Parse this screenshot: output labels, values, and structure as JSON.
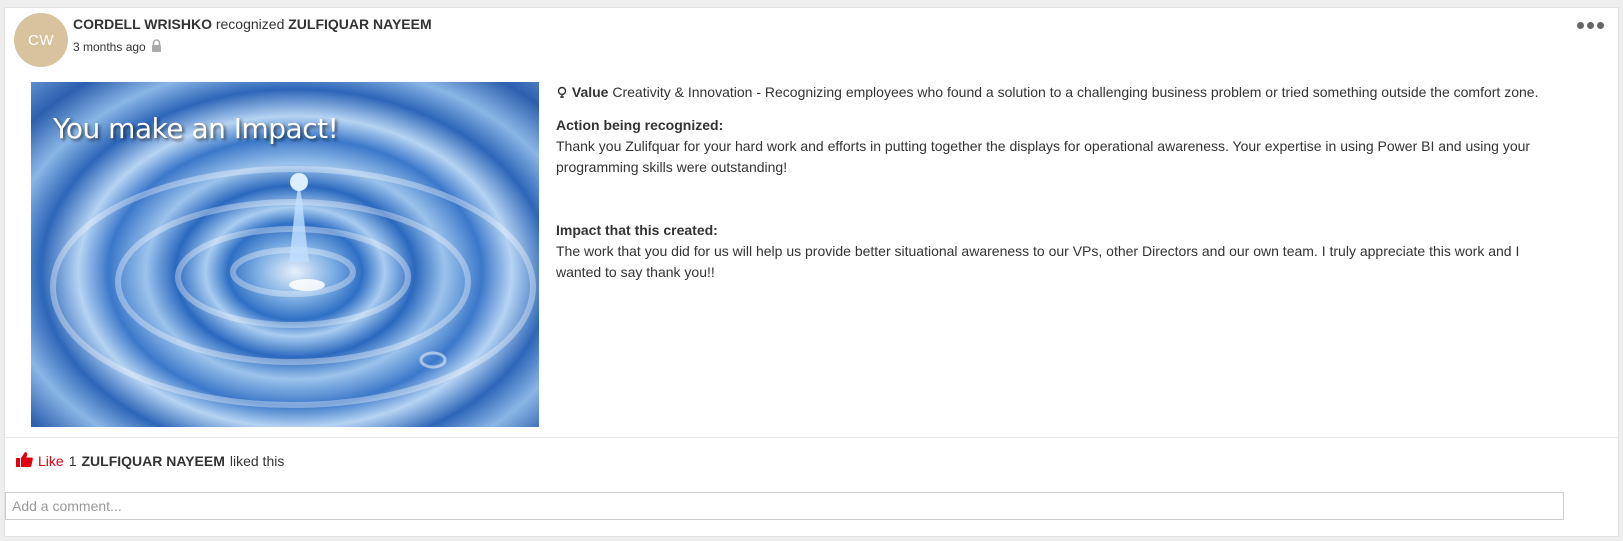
{
  "post": {
    "author_initials": "CW",
    "author_name": "CORDELL WRISHKO",
    "verb": "recognized",
    "recipient_name": "ZULFIQUAR NAYEEM",
    "timestamp": "3 months ago",
    "privacy_icon": "lock-icon",
    "image_caption": "You make an Impact!",
    "value_label": "Value",
    "value_text": "Creativity & Innovation - Recognizing employees who found a solution to a challenging business problem or tried something outside the comfort zone.",
    "action_heading": "Action being recognized:",
    "action_text": "Thank you Zulifquar for your hard work and efforts in putting together the displays for operational awareness.  Your expertise in using Power BI and using your programming skills were outstanding!",
    "impact_heading": "Impact that this created:",
    "impact_text": "The work that you did for us will help us provide better situational awareness to our VPs, other Directors and our own team.  I truly appreciate this work and I wanted to say thank you!!"
  },
  "likes": {
    "label": "Like",
    "count": "1",
    "liker_name": "ZULFIQUAR NAYEEM",
    "suffix": "liked this"
  },
  "comment": {
    "placeholder": "Add a comment..."
  },
  "colors": {
    "avatar_bg": "#d9c29e",
    "like_red": "#e3000f"
  }
}
